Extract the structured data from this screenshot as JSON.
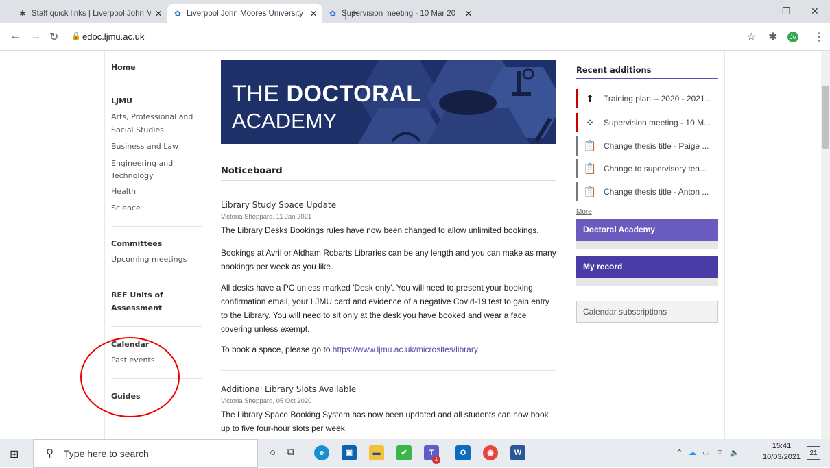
{
  "browser": {
    "tabs": [
      {
        "title": "Staff quick links | Liverpool John M",
        "favicon": "ljmu-logo-icon"
      },
      {
        "title": "Liverpool John Moores University",
        "favicon": "ljmu-gear-icon"
      },
      {
        "title": "Supervision meeting - 10 Mar 20",
        "favicon": "ljmu-gear-icon"
      }
    ],
    "url": "edoc.ljmu.ac.uk",
    "avatar_initials": "Jo"
  },
  "sidebar": {
    "home": "Home",
    "ljmu_heading": "LJMU",
    "ljmu_items": [
      "Arts, Professional and",
      "Social Studies",
      "Business and Law",
      "Engineering and",
      "Technology",
      "Health",
      "Science"
    ],
    "committees_heading": "Committees",
    "committees_items": [
      "Upcoming meetings"
    ],
    "ref_heading_1": "REF Units of",
    "ref_heading_2": "Assessment",
    "calendar_heading": "Calendar",
    "calendar_items": [
      "Past events"
    ],
    "guides_heading": "Guides"
  },
  "banner": {
    "line1_light": "THE ",
    "line1_bold": "DOCTORAL",
    "line2": "ACADEMY"
  },
  "noticeboard": {
    "heading": "Noticeboard",
    "posts": [
      {
        "title": "Library Study Space Update",
        "meta": "Victoria Sheppard, 11 Jan 2021",
        "paragraphs": [
          "The Library Desks Bookings rules have now been changed to allow unlimited bookings.",
          "Bookings at Avril or Aldham Robarts Libraries can be any length and you can make as many bookings per week as you like.",
          "All desks have a PC unless marked 'Desk only'. You will need to present your booking confirmation email, your LJMU card and evidence of a negative Covid-19 test to gain entry to the Library. You will need to sit only at the desk you have booked and wear a face covering unless exempt."
        ],
        "link_prefix": "To book a space, please go to ",
        "link_text": "https://www.ljmu.ac.uk/microsites/library"
      },
      {
        "title": "Additional Library Slots Available",
        "meta": "Victoria Sheppard, 05 Oct 2020",
        "paragraphs": [
          "The Library Space Booking System has now been updated and all students can now book up to five four-hour slots per week."
        ]
      }
    ]
  },
  "recent": {
    "heading": "Recent additions",
    "items": [
      {
        "label": "Training plan -- 2020 - 2021...",
        "icon": "upload-circle-icon",
        "marker": "red"
      },
      {
        "label": "Supervision meeting - 10 M...",
        "icon": "network-icon",
        "marker": "red"
      },
      {
        "label": "Change thesis title - Paige ...",
        "icon": "clipboard-edit-icon",
        "marker": "gray"
      },
      {
        "label": "Change to supervisory tea...",
        "icon": "clipboard-edit-icon",
        "marker": "gray"
      },
      {
        "label": "Change thesis title - Anton ...",
        "icon": "clipboard-edit-icon",
        "marker": "gray"
      }
    ],
    "more": "More",
    "doctoral_academy": "Doctoral Academy",
    "my_record": "My record",
    "calendar_subscriptions": "Calendar subscriptions"
  },
  "taskbar": {
    "search_placeholder": "Type here to search",
    "time": "15:41",
    "date": "10/03/2021",
    "notifications": "21",
    "teams_badge": "1"
  }
}
